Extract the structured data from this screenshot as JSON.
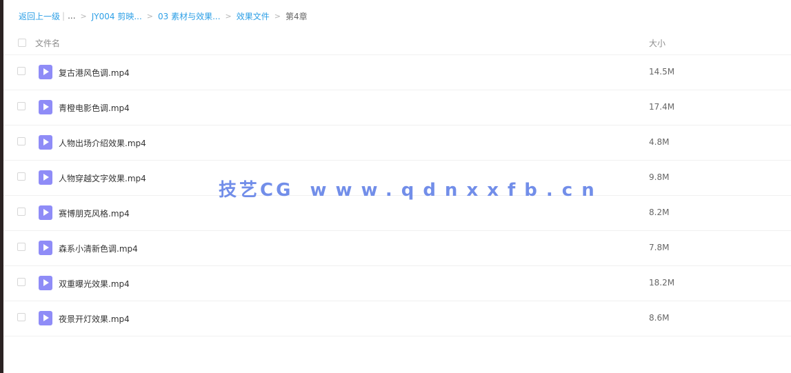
{
  "breadcrumb": {
    "back": "返回上一级",
    "ellipsis": "...",
    "items": [
      "JY004 剪映...",
      "03 素材与效果...",
      "效果文件"
    ],
    "current": "第4章"
  },
  "table": {
    "columns": {
      "name": "文件名",
      "size": "大小"
    },
    "rows": [
      {
        "name": "复古港风色调.mp4",
        "size": "14.5M",
        "icon": "video-file-icon"
      },
      {
        "name": "青橙电影色调.mp4",
        "size": "17.4M",
        "icon": "video-file-icon"
      },
      {
        "name": "人物出场介绍效果.mp4",
        "size": "4.8M",
        "icon": "video-file-icon"
      },
      {
        "name": "人物穿越文字效果.mp4",
        "size": "9.8M",
        "icon": "video-file-icon"
      },
      {
        "name": "赛博朋克风格.mp4",
        "size": "8.2M",
        "icon": "video-file-icon"
      },
      {
        "name": "森系小清新色调.mp4",
        "size": "7.8M",
        "icon": "video-file-icon"
      },
      {
        "name": "双重曝光效果.mp4",
        "size": "18.2M",
        "icon": "video-file-icon"
      },
      {
        "name": "夜景开灯效果.mp4",
        "size": "8.6M",
        "icon": "video-file-icon"
      }
    ]
  },
  "watermark": {
    "brand": "技艺CG",
    "url": "www.qdnxxfb.cn"
  },
  "colors": {
    "link": "#2d9fe6",
    "file_icon": "#8f8cf7",
    "watermark": "#6b88e8"
  }
}
